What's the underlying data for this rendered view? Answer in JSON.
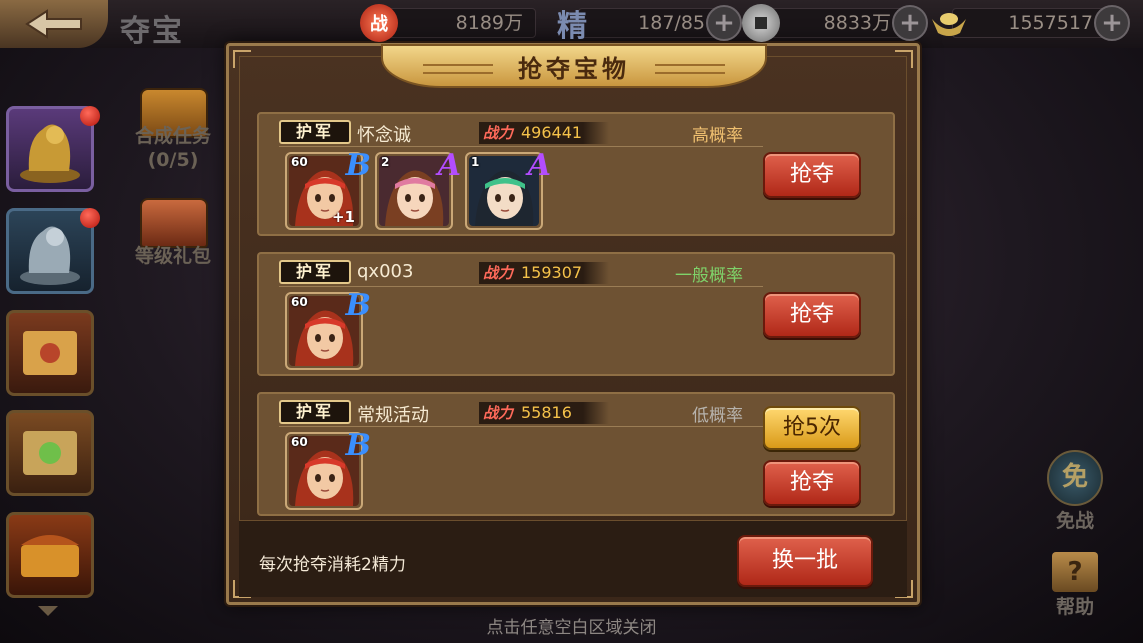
{
  "topbar": {
    "title": "夺宝",
    "resources": [
      {
        "icon": "battle-power-icon",
        "icon_text": "战",
        "value": "8189万",
        "has_plus": false
      },
      {
        "icon": "stamina-icon",
        "icon_text": "精",
        "value": "187/85",
        "has_plus": true
      },
      {
        "icon": "coin-icon",
        "icon_text": "",
        "value": "8833万",
        "has_plus": true
      },
      {
        "icon": "gold-ingot-icon",
        "icon_text": "",
        "value": "1557517",
        "has_plus": true
      }
    ]
  },
  "sidebar": {
    "synthesis_label": "合成任务",
    "synthesis_progress": "(0/5)",
    "level_gift_label": "等级礼包"
  },
  "right_panel": {
    "avoid_battle_label": "免战",
    "avoid_battle_glyph": "免",
    "help_label": "帮助",
    "help_glyph": "?"
  },
  "dialog": {
    "title": "抢夺宝物",
    "tag_label": "护军",
    "power_label": "战力",
    "rows": [
      {
        "name": "怀念诚",
        "power": "496441",
        "probability": "高概率",
        "probability_color": "#f0c070",
        "heroes": [
          {
            "level": "60",
            "grade": "B",
            "grade_color": "#3a8fff",
            "bonus": "+1",
            "face": "red-hair-warrior"
          },
          {
            "level": "2",
            "grade": "A",
            "grade_color": "#b34dff",
            "bonus": "",
            "face": "brown-hair-girl"
          },
          {
            "level": "1",
            "grade": "A",
            "grade_color": "#b34dff",
            "bonus": "",
            "face": "dark-hair-girl"
          }
        ],
        "buttons": [
          "抢夺"
        ]
      },
      {
        "name": "qx003",
        "power": "159307",
        "probability": "一般概率",
        "probability_color": "#7fd36a",
        "heroes": [
          {
            "level": "60",
            "grade": "B",
            "grade_color": "#3a8fff",
            "bonus": "",
            "face": "red-hair-warrior"
          }
        ],
        "buttons": [
          "抢夺"
        ]
      },
      {
        "name": "常规活动",
        "power": "55816",
        "probability": "低概率",
        "probability_color": "#b7b3ad",
        "heroes": [
          {
            "level": "60",
            "grade": "B",
            "grade_color": "#3a8fff",
            "bonus": "",
            "face": "red-hair-warrior"
          }
        ],
        "buttons": [
          "抢5次",
          "抢夺"
        ]
      }
    ],
    "cost_text": "每次抢夺消耗2精力",
    "refresh_label": "换一批"
  },
  "hint": "点击任意空白区域关闭"
}
